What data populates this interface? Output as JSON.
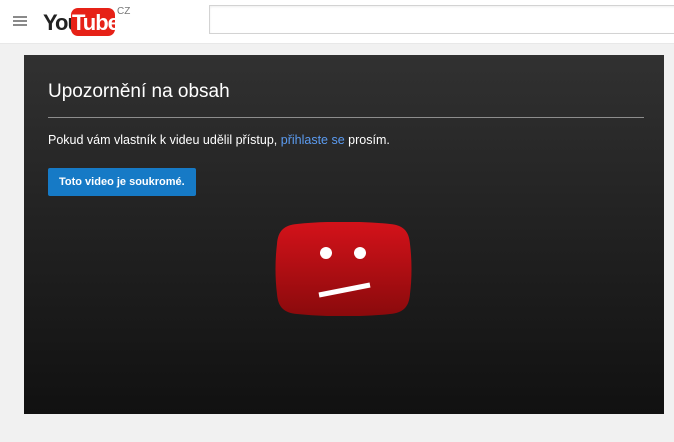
{
  "header": {
    "logo_you": "You",
    "logo_tube": "Tube",
    "country_code": "CZ",
    "search": {
      "value": "",
      "placeholder": ""
    }
  },
  "player": {
    "title": "Upozornění na obsah",
    "message_prefix": "Pokud vám vlastník k videu udělil přístup, ",
    "login_link": "přihlaste se",
    "message_suffix": " prosím.",
    "private_button": "Toto video je soukromé.",
    "icon": "sad-face-play-icon"
  },
  "colors": {
    "brand_red": "#e62117",
    "link_blue": "#5b9bf0",
    "button_blue": "#167ac6",
    "player_bg": "#1f1f1f"
  }
}
